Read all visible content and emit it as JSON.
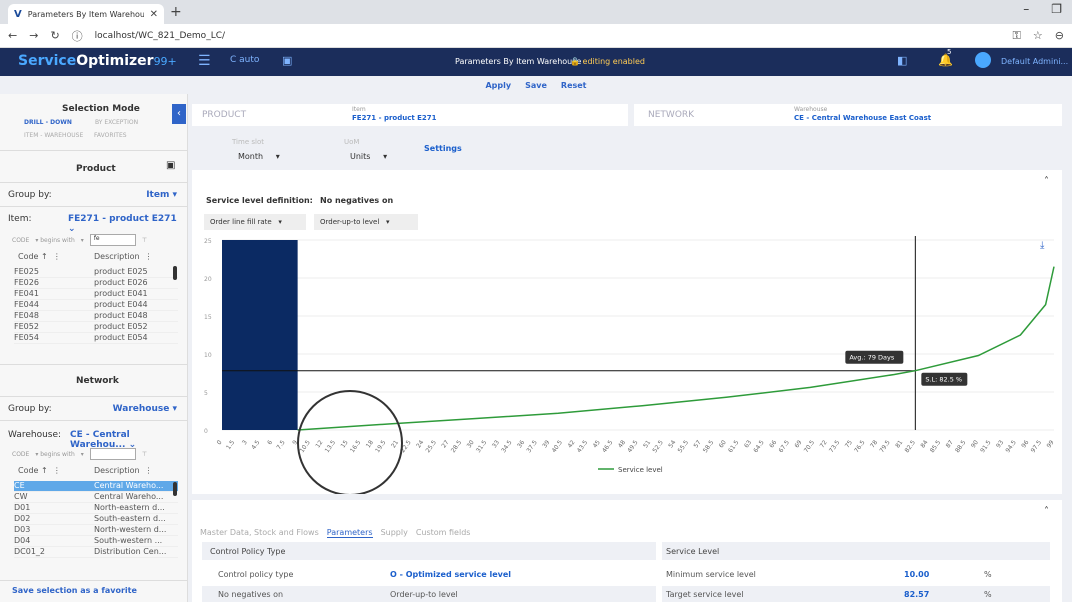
{
  "browser": {
    "tab_title": "Parameters By Item Warehouse",
    "url": "localhost/WC_821_Demo_LC/"
  },
  "app": {
    "logo_part1": "Service",
    "logo_part2": "Optimizer",
    "logo_part3": "99+",
    "auto_label": "auto",
    "page_title": "Parameters By Item Warehouse",
    "edit_status": "editing enabled",
    "notification_count": "5",
    "user_name": "Default Admini..."
  },
  "actions": {
    "apply": "Apply",
    "save": "Save",
    "reset": "Reset"
  },
  "sidebar": {
    "selection_mode_title": "Selection Mode",
    "mode_drilldown": "DRILL - DOWN",
    "mode_exception": "BY EXCEPTION",
    "mode_itemwarehouse": "ITEM - WAREHOUSE",
    "mode_favorites": "FAVORITES",
    "product_title": "Product",
    "product_groupby_label": "Group by:",
    "product_groupby_value": "Item",
    "item_label": "Item:",
    "item_value": "FE271 - product E271",
    "product_filter_field": "CODE",
    "product_filter_op": "begins with",
    "product_filter_text": "fe",
    "col_code": "Code",
    "col_desc": "Description",
    "products": [
      {
        "code": "FE025",
        "desc": "product E025"
      },
      {
        "code": "FE026",
        "desc": "product E026"
      },
      {
        "code": "FE041",
        "desc": "product E041"
      },
      {
        "code": "FE044",
        "desc": "product E044"
      },
      {
        "code": "FE048",
        "desc": "product E048"
      },
      {
        "code": "FE052",
        "desc": "product E052"
      },
      {
        "code": "FE054",
        "desc": "product E054"
      }
    ],
    "network_title": "Network",
    "network_groupby_label": "Group by:",
    "network_groupby_value": "Warehouse",
    "warehouse_label": "Warehouse:",
    "warehouse_value": "CE - Central Warehou...",
    "network_filter_field": "CODE",
    "network_filter_op": "begins with",
    "warehouses": [
      {
        "code": "CE",
        "desc": "Central Wareho..."
      },
      {
        "code": "CW",
        "desc": "Central Wareho..."
      },
      {
        "code": "D01",
        "desc": "North-eastern d..."
      },
      {
        "code": "D02",
        "desc": "South-eastern d..."
      },
      {
        "code": "D03",
        "desc": "North-western d..."
      },
      {
        "code": "D04",
        "desc": "South-western ..."
      },
      {
        "code": "DC01_2",
        "desc": "Distribution Cen..."
      }
    ],
    "save_favorite": "Save selection as a favorite"
  },
  "main": {
    "product_label": "PRODUCT",
    "item_small": "Item",
    "item_value": "FE271 - product E271",
    "network_label": "NETWORK",
    "warehouse_small": "Warehouse",
    "warehouse_value": "CE - Central Warehouse East Coast",
    "timeslot_label": "Time slot",
    "timeslot_value": "Month",
    "uom_label": "UoM",
    "uom_value": "Units",
    "settings": "Settings",
    "sl_def_label": "Service level definition:",
    "sl_def_value": "Order line fill rate",
    "no_neg_label": "No negatives on",
    "no_neg_value": "Order-up-to level",
    "tabs": [
      "Master Data, Stock and Flows",
      "Parameters",
      "Supply",
      "Custom fields"
    ],
    "control_policy_header": "Control Policy Type",
    "control_policy_label": "Control policy type",
    "control_policy_value": "O - Optimized service level",
    "no_negatives_label": "No negatives on",
    "no_negatives_value": "Order-up-to level",
    "service_level_header": "Service Level",
    "min_sl_label": "Minimum service level",
    "min_sl_value": "10.00",
    "target_sl_label": "Target service level",
    "target_sl_value": "82.57",
    "percent": "%"
  },
  "chart_data": {
    "type": "line",
    "legend": "Service level",
    "avg_label": "Avg.: 79 Days",
    "sl_label": "S.L: 82.5 %",
    "y_ticks": [
      0,
      5,
      10,
      15,
      20,
      25
    ],
    "ylim": [
      0,
      25
    ],
    "x_ticks": [
      "0",
      "1.5",
      "3",
      "4.5",
      "6",
      "7.5",
      "9",
      "10.5",
      "12",
      "13.5",
      "15",
      "16.5",
      "18",
      "19.5",
      "21",
      "22.5",
      "24",
      "25.5",
      "27",
      "28.5",
      "30",
      "31.5",
      "33",
      "34.5",
      "36",
      "37.5",
      "39",
      "40.5",
      "42",
      "43.5",
      "45",
      "46.5",
      "48",
      "49.5",
      "51",
      "52.5",
      "54",
      "55.5",
      "57",
      "58.5",
      "60",
      "61.5",
      "63",
      "64.5",
      "66",
      "67.5",
      "69",
      "70.5",
      "72",
      "73.5",
      "75",
      "76.5",
      "78",
      "79.5",
      "81",
      "82.5",
      "84",
      "85.5",
      "87",
      "88.5",
      "90",
      "91.5",
      "93",
      "94.5",
      "96",
      "97.5",
      "99"
    ],
    "bar": {
      "x_start": 0,
      "x_end": 9,
      "value": 25
    },
    "line": {
      "x": [
        9,
        20,
        30,
        40,
        50,
        60,
        70,
        80,
        82.5,
        90,
        95,
        98,
        99
      ],
      "y": [
        0,
        0.8,
        1.5,
        2.2,
        3.2,
        4.3,
        5.6,
        7.3,
        7.8,
        9.8,
        12.5,
        16.5,
        21.5
      ]
    },
    "avg_y": 7.8,
    "sl_x": 82.5
  },
  "colors": {
    "header": "#1b2d5b",
    "accent": "#2f64c8",
    "bar": "#0b2a63",
    "line": "#2e9b3a"
  }
}
